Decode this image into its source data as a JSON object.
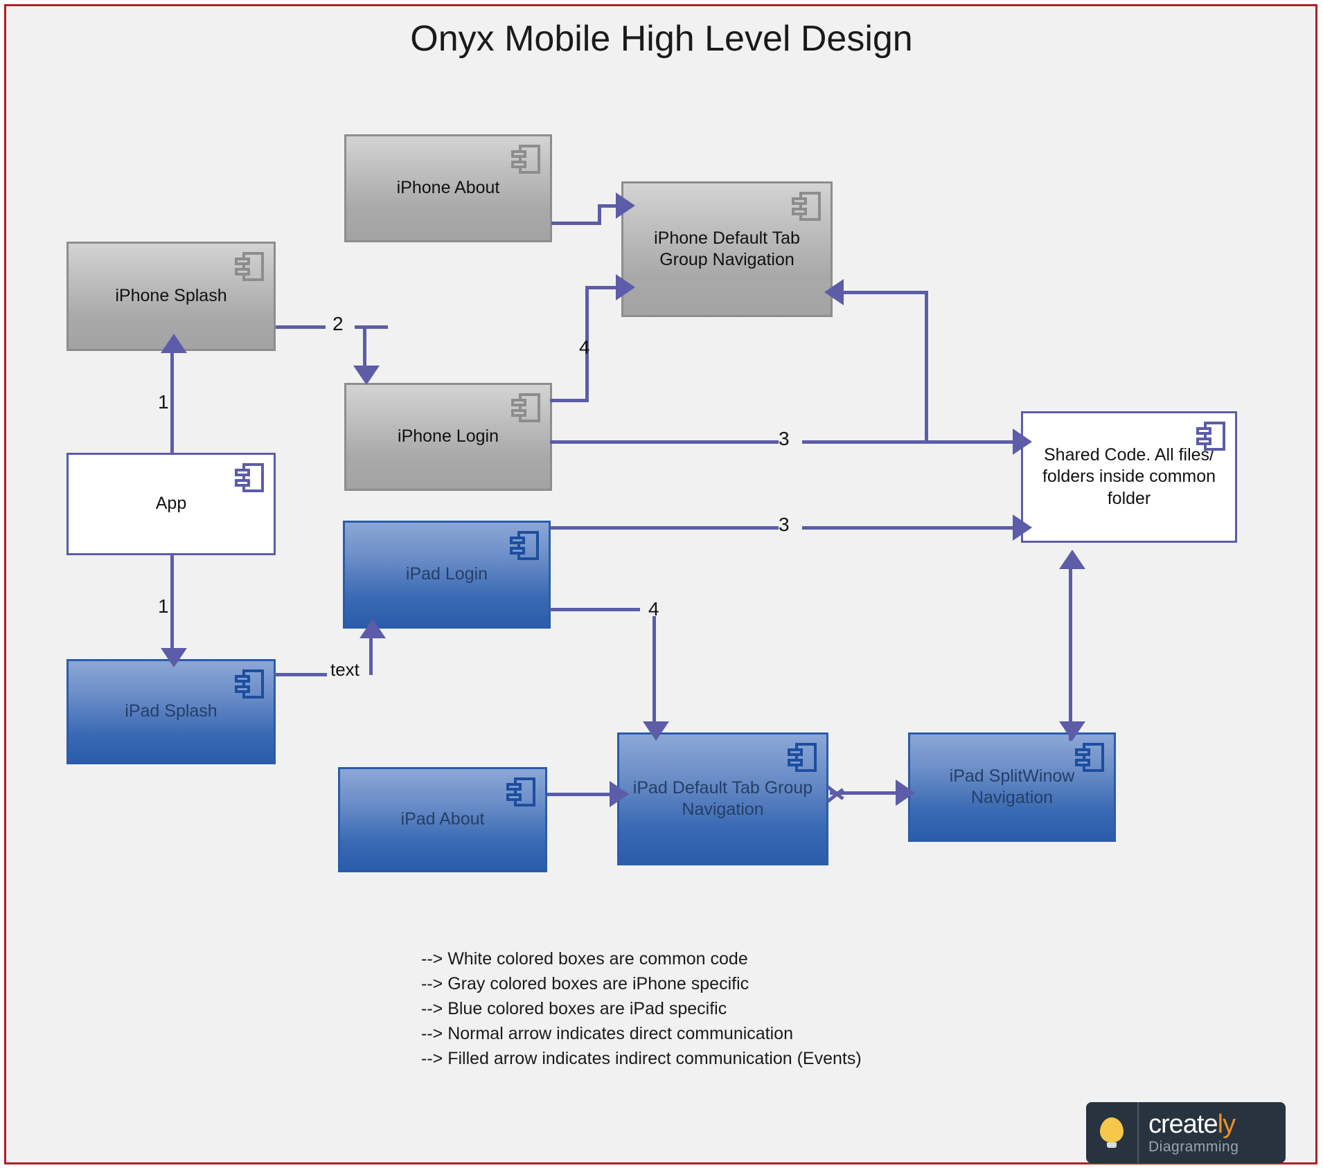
{
  "title": "Onyx Mobile High Level Design",
  "colors": {
    "frame_border": "#b01f24",
    "canvas_bg": "#f1f1f1",
    "connector": "#5c5ca8",
    "gray_box_border": "#8d8d8d",
    "blue_box_border": "#2a5caa",
    "white_box_border": "#5c5ca8",
    "blue_text": "#243f66",
    "creately_bg": "#27333f",
    "creately_bulb": "#f5c84b",
    "creately_accent": "#f0911e"
  },
  "nodes": {
    "iphone_about": {
      "label": "iPhone About",
      "type": "gray"
    },
    "iphone_splash": {
      "label": "iPhone Splash",
      "type": "gray"
    },
    "iphone_login": {
      "label": "iPhone Login",
      "type": "gray"
    },
    "iphone_tab_nav": {
      "label": "iPhone Default Tab Group Navigation",
      "type": "gray"
    },
    "app": {
      "label": "App",
      "type": "white"
    },
    "shared_code": {
      "label": "Shared Code. All files/ folders inside common folder",
      "type": "white"
    },
    "ipad_splash": {
      "label": "iPad Splash",
      "type": "blue"
    },
    "ipad_login": {
      "label": "iPad Login",
      "type": "blue"
    },
    "ipad_about": {
      "label": "iPad About",
      "type": "blue"
    },
    "ipad_tab_nav": {
      "label": "iPad Default Tab Group Navigation",
      "type": "blue"
    },
    "ipad_split_nav": {
      "label": "iPad SplitWinow Navigation",
      "type": "blue"
    }
  },
  "edge_labels": {
    "app_to_iphone_splash": "1",
    "app_to_ipad_splash": "1",
    "iphone_splash_to_login": "2",
    "iphone_login_to_shared": "3",
    "ipad_login_to_shared": "3",
    "iphone_login_to_tabnav": "4",
    "ipad_login_to_tabnav": "4",
    "ipad_splash_to_login": "text"
  },
  "legend": [
    "--> White colored boxes are common code",
    "--> Gray colored boxes are iPhone specific",
    "--> Blue colored boxes are iPad specific",
    "--> Normal arrow indicates direct communication",
    "--> Filled arrow indicates indirect communication (Events)"
  ],
  "creately": {
    "name_main": "create",
    "name_accent": "ly",
    "tagline": "Diagramming"
  }
}
